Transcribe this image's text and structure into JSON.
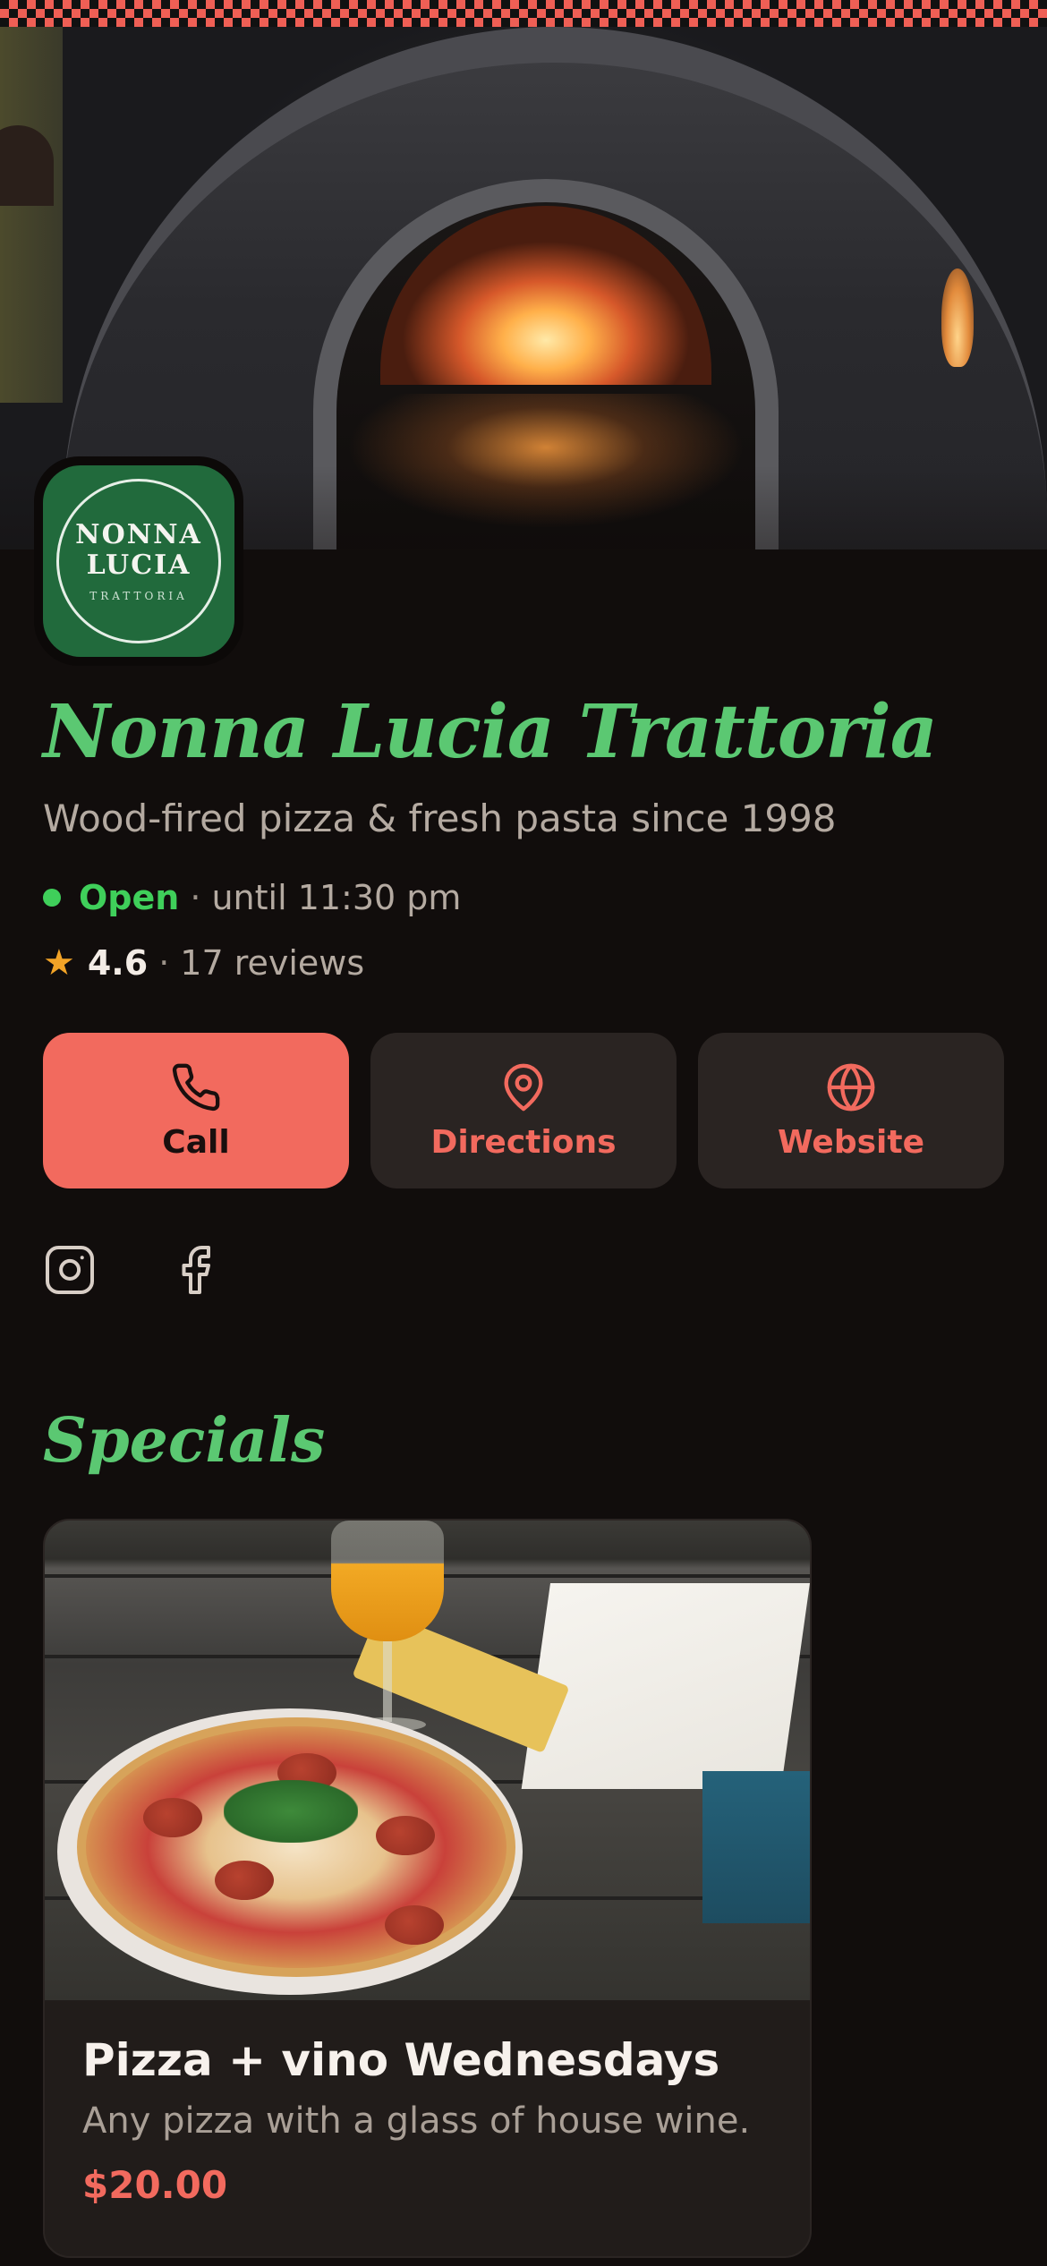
{
  "restaurant": {
    "name": "Nonna Lucia Trattoria",
    "tagline": "Wood-fired pizza & fresh pasta since 1998",
    "logo": {
      "line1": "NONNA",
      "line2": "LUCIA",
      "line3": "TRATTORIA"
    }
  },
  "status": {
    "open_label": "Open",
    "separator": "·",
    "hours": "until 11:30 pm",
    "dot_color": "#3fcf5a"
  },
  "rating": {
    "star": "★",
    "value": "4.6",
    "separator": "·",
    "reviews": "17 reviews"
  },
  "actions": [
    {
      "label": "Call",
      "icon": "phone-icon"
    },
    {
      "label": "Directions",
      "icon": "map-pin-icon"
    },
    {
      "label": "Website",
      "icon": "globe-icon"
    }
  ],
  "social": [
    {
      "icon": "instagram-icon"
    },
    {
      "icon": "facebook-icon"
    }
  ],
  "specials": {
    "section_title": "Specials",
    "items": [
      {
        "title": "Pizza + vino Wednesdays",
        "description": "Any pizza with a glass of house wine.",
        "price": "$20.00"
      }
    ]
  },
  "colors": {
    "background": "#110d0c",
    "brand_green": "#5bc872",
    "accent_coral": "#f26a5e",
    "logo_green": "#216a3c",
    "star_gold": "#f2a327"
  }
}
